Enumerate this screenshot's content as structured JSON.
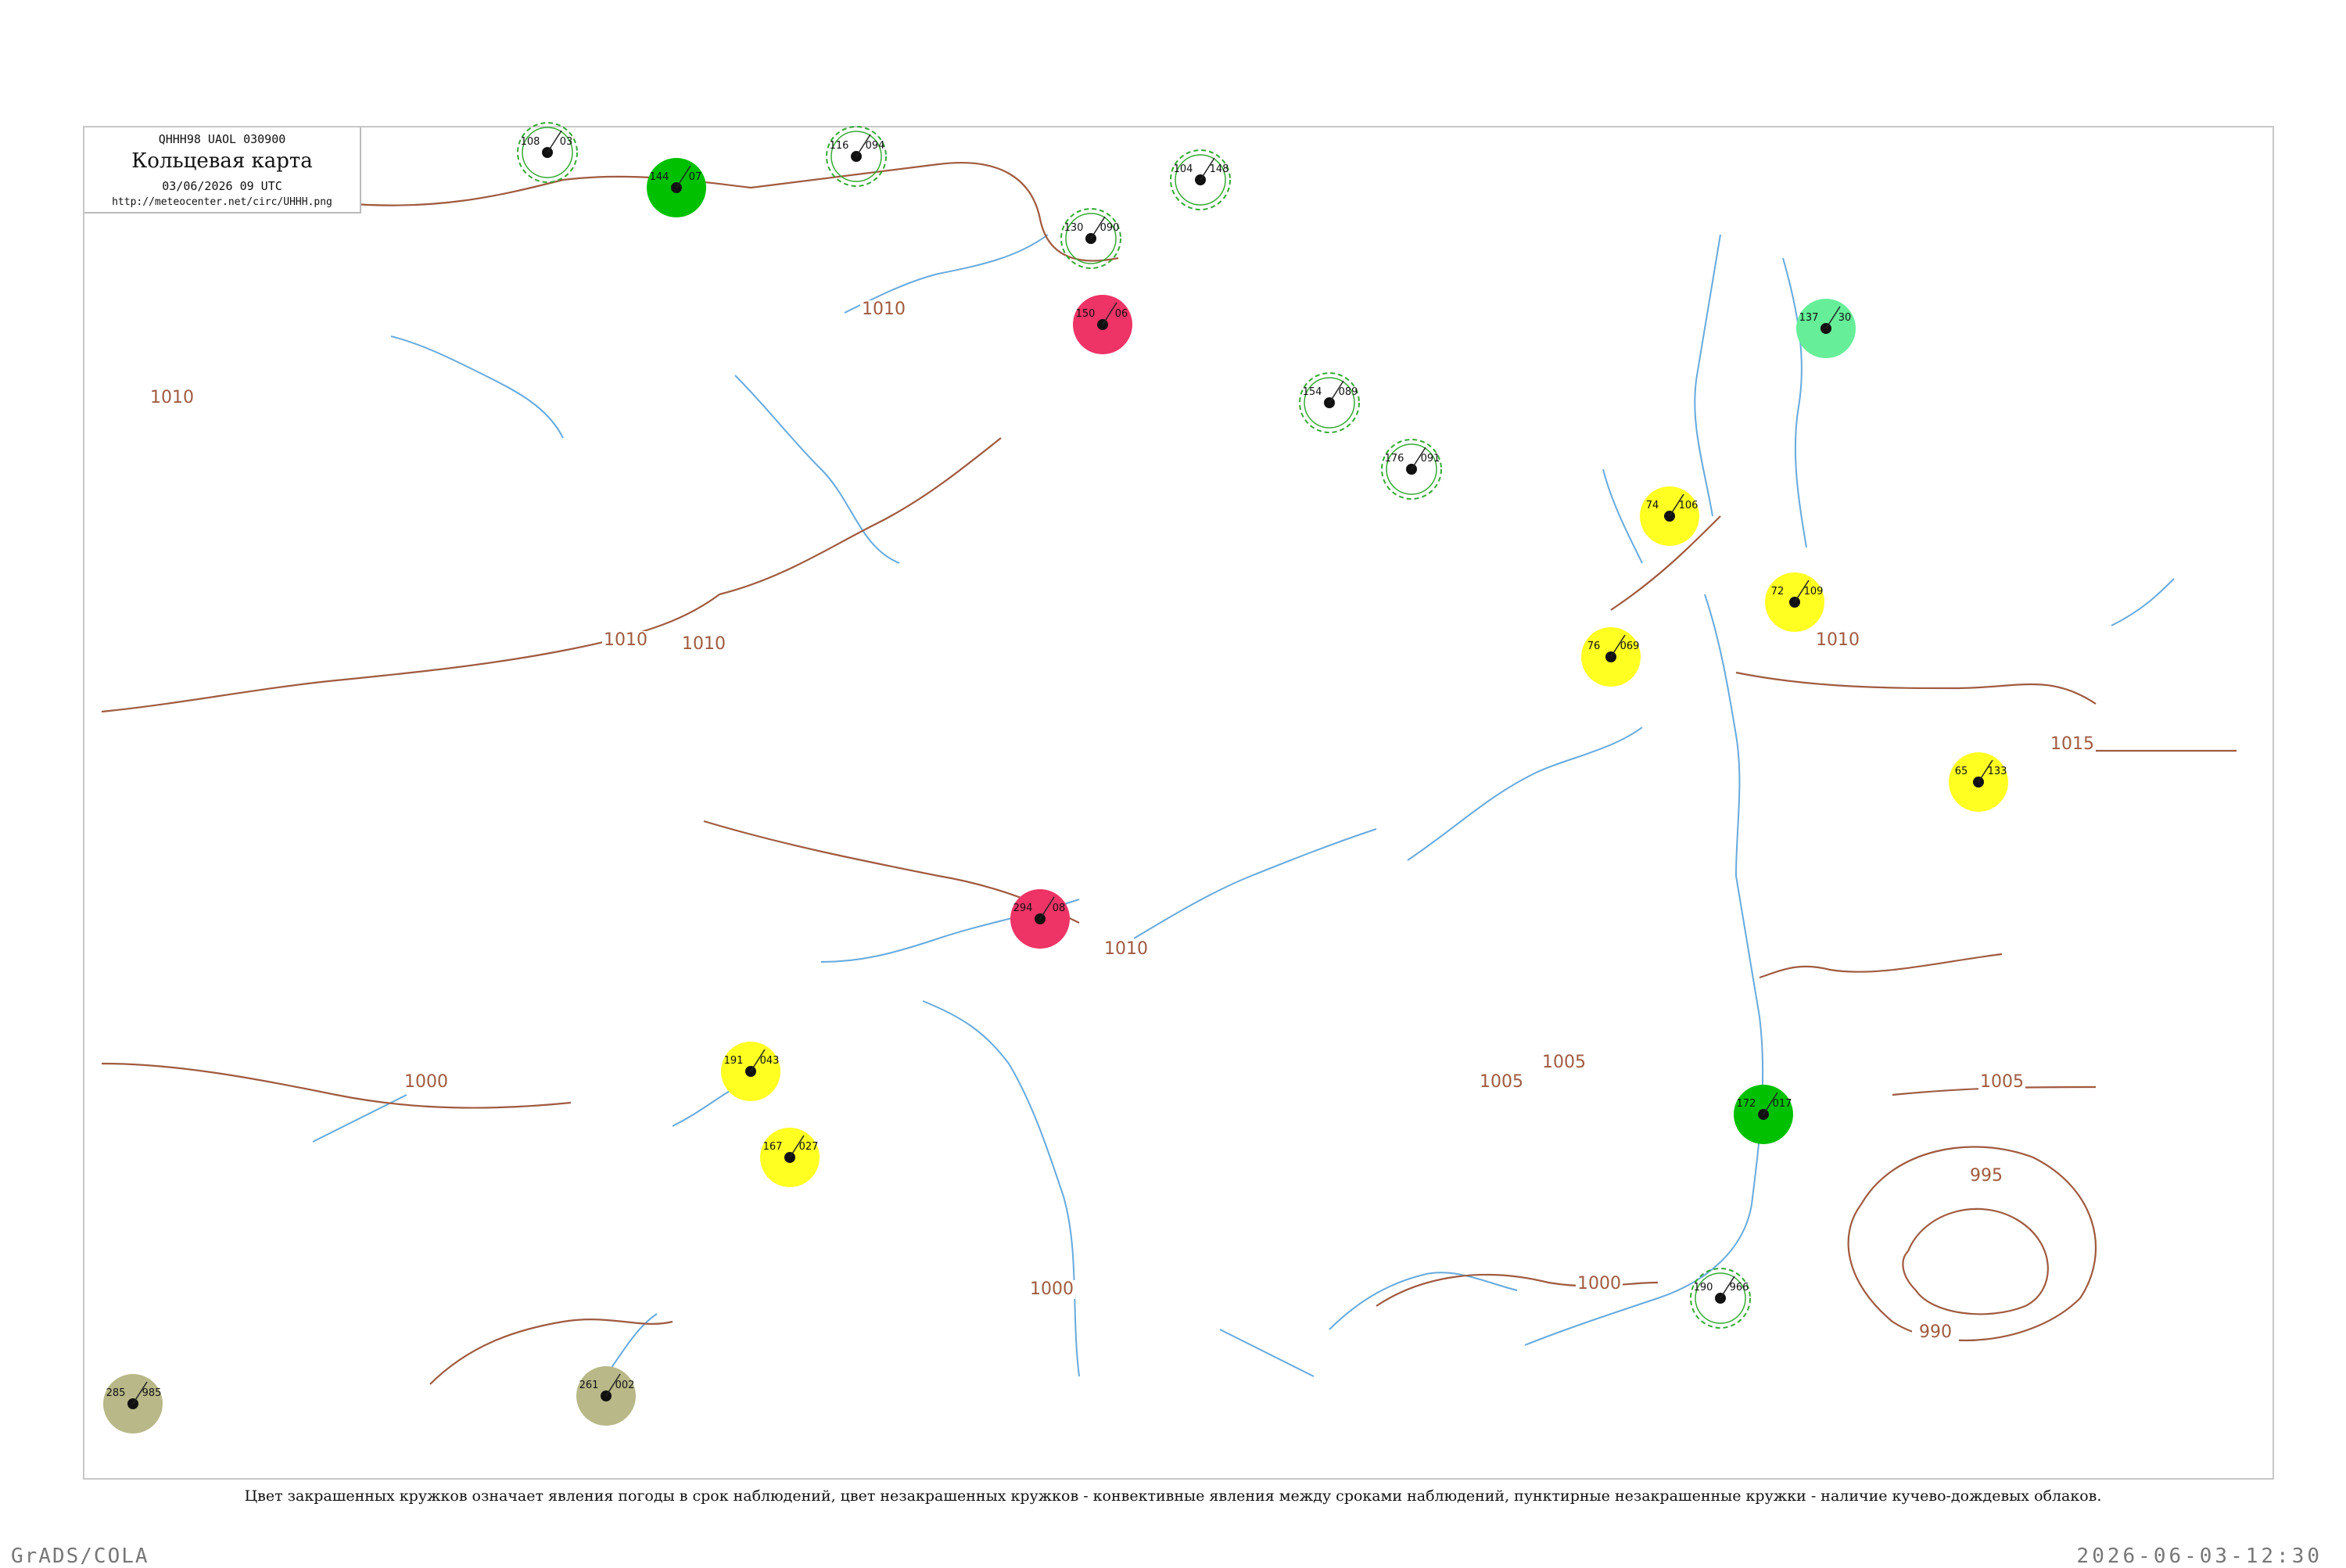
{
  "header": {
    "code": "QHHH98  UAOL  030900",
    "title": "Кольцевая карта",
    "date": "03/06/2026 09 UTC",
    "url": "http://meteocenter.net/circ/UHHH.png"
  },
  "caption": "Цвет закрашенных кружков означает явления погоды в срок наблюдений, цвет незакрашенных кружков - конвективные явления между сроками наблюдений, пунктирные незакрашенные кружки - наличие кучево-дождевых облаков.",
  "footer": {
    "left": "GrADS/COLA",
    "right": "2026-06-03-12:30"
  },
  "colors": {
    "rain": "#00c000",
    "showers": "#66ee99",
    "fog": "#ffff22",
    "thunder": "#ee3366",
    "dust": "#b8b888",
    "cb_dash": "#33aa33",
    "isobar": "#a05a40",
    "river": "#66aadd"
  },
  "isobars": [
    {
      "label": "1010"
    },
    {
      "label": "1010"
    },
    {
      "label": "1010"
    },
    {
      "label": "1010"
    },
    {
      "label": "1010"
    },
    {
      "label": "1010"
    },
    {
      "label": "1015"
    },
    {
      "label": "1005"
    },
    {
      "label": "1005"
    },
    {
      "label": "1005"
    },
    {
      "label": "1000"
    },
    {
      "label": "1000"
    },
    {
      "label": "1000"
    },
    {
      "label": "995"
    },
    {
      "label": "990"
    }
  ],
  "stations": [
    {
      "p": "108",
      "t": "03",
      "id": "r1",
      "kind": "cb"
    },
    {
      "p": "144",
      "t": "07",
      "id": "r2",
      "kind": "rain"
    },
    {
      "p": "116",
      "t": "094",
      "id": "r3",
      "kind": "cb"
    },
    {
      "p": "130",
      "t": "090",
      "id": "r4",
      "kind": "cb"
    },
    {
      "p": "104",
      "t": "148",
      "id": "r5",
      "kind": "obs"
    },
    {
      "p": "150",
      "t": "06",
      "id": "r6",
      "kind": "thunder"
    },
    {
      "p": "154",
      "t": "089",
      "id": "r7",
      "kind": "cb"
    },
    {
      "p": "176",
      "t": "091",
      "id": "r8",
      "kind": "cb"
    },
    {
      "p": "74",
      "t": "106",
      "id": "r9",
      "kind": "fog"
    },
    {
      "p": "76",
      "t": "069",
      "id": "r10",
      "kind": "fog"
    },
    {
      "p": "72",
      "t": "109",
      "id": "r11",
      "kind": "fog"
    },
    {
      "p": "65",
      "t": "133",
      "id": "r12",
      "kind": "fog"
    },
    {
      "p": "191",
      "t": "043",
      "id": "r13",
      "kind": "fog"
    },
    {
      "p": "167",
      "t": "027",
      "id": "r14",
      "kind": "fog"
    },
    {
      "p": "294",
      "t": "08",
      "id": "r15",
      "kind": "thunder"
    },
    {
      "p": "285",
      "t": "985",
      "id": "r16",
      "kind": "dust"
    },
    {
      "p": "261",
      "t": "002",
      "id": "r17",
      "kind": "dust"
    },
    {
      "p": "137",
      "t": "30",
      "id": "r18",
      "kind": "showers"
    },
    {
      "p": "190",
      "t": "966",
      "id": "r19",
      "kind": "cb"
    },
    {
      "p": "172",
      "t": "017",
      "id": "r20",
      "kind": "rain"
    }
  ]
}
